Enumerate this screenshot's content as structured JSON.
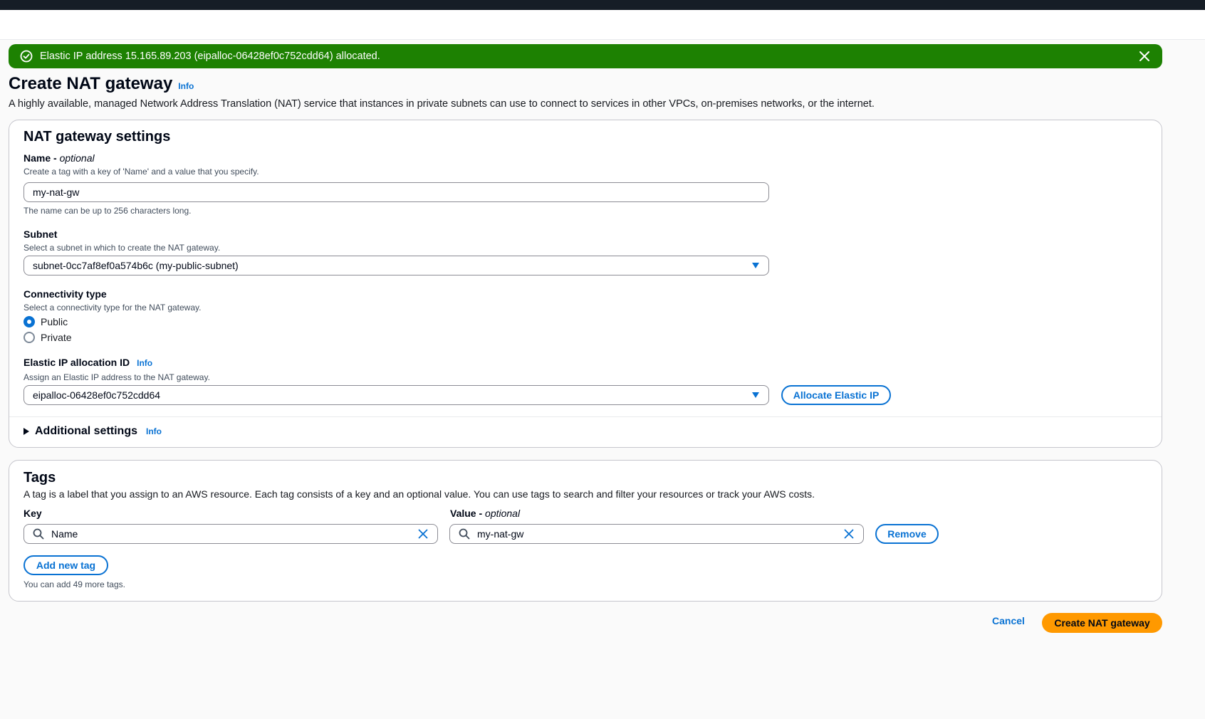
{
  "flash": {
    "message": "Elastic IP address 15.165.89.203 (eipalloc-06428ef0c752cdd64) allocated.",
    "color": "#1d8102"
  },
  "page": {
    "title": "Create NAT gateway",
    "info": "Info",
    "description": "A highly available, managed Network Address Translation (NAT) service that instances in private subnets can use to connect to services in other VPCs, on-premises networks, or the internet."
  },
  "settings": {
    "heading": "NAT gateway settings",
    "name": {
      "label": "Name - ",
      "optional": "optional",
      "description": "Create a tag with a key of 'Name' and a value that you specify.",
      "value": "my-nat-gw",
      "hint": "The name can be up to 256 characters long."
    },
    "subnet": {
      "label": "Subnet",
      "description": "Select a subnet in which to create the NAT gateway.",
      "value": "subnet-0cc7af8ef0a574b6c (my-public-subnet)"
    },
    "connectivity": {
      "label": "Connectivity type",
      "description": "Select a connectivity type for the NAT gateway.",
      "options": [
        "Public",
        "Private"
      ],
      "selected": "Public"
    },
    "eip": {
      "label": "Elastic IP allocation ID",
      "info": "Info",
      "description": "Assign an Elastic IP address to the NAT gateway.",
      "value": "eipalloc-06428ef0c752cdd64",
      "allocate_button": "Allocate Elastic IP"
    },
    "additional": {
      "label": "Additional settings",
      "info": "Info"
    }
  },
  "tags": {
    "heading": "Tags",
    "description": "A tag is a label that you assign to an AWS resource. Each tag consists of a key and an optional value. You can use tags to search and filter your resources or track your AWS costs.",
    "key_label": "Key",
    "value_label": "Value - ",
    "value_optional": "optional",
    "rows": [
      {
        "key": "Name",
        "value": "my-nat-gw"
      }
    ],
    "remove_button": "Remove",
    "add_button": "Add new tag",
    "limit_hint": "You can add 49 more tags."
  },
  "footer": {
    "cancel": "Cancel",
    "create": "Create NAT gateway"
  },
  "colors": {
    "accent": "#0972d3",
    "primary_button": "#ff9900"
  }
}
